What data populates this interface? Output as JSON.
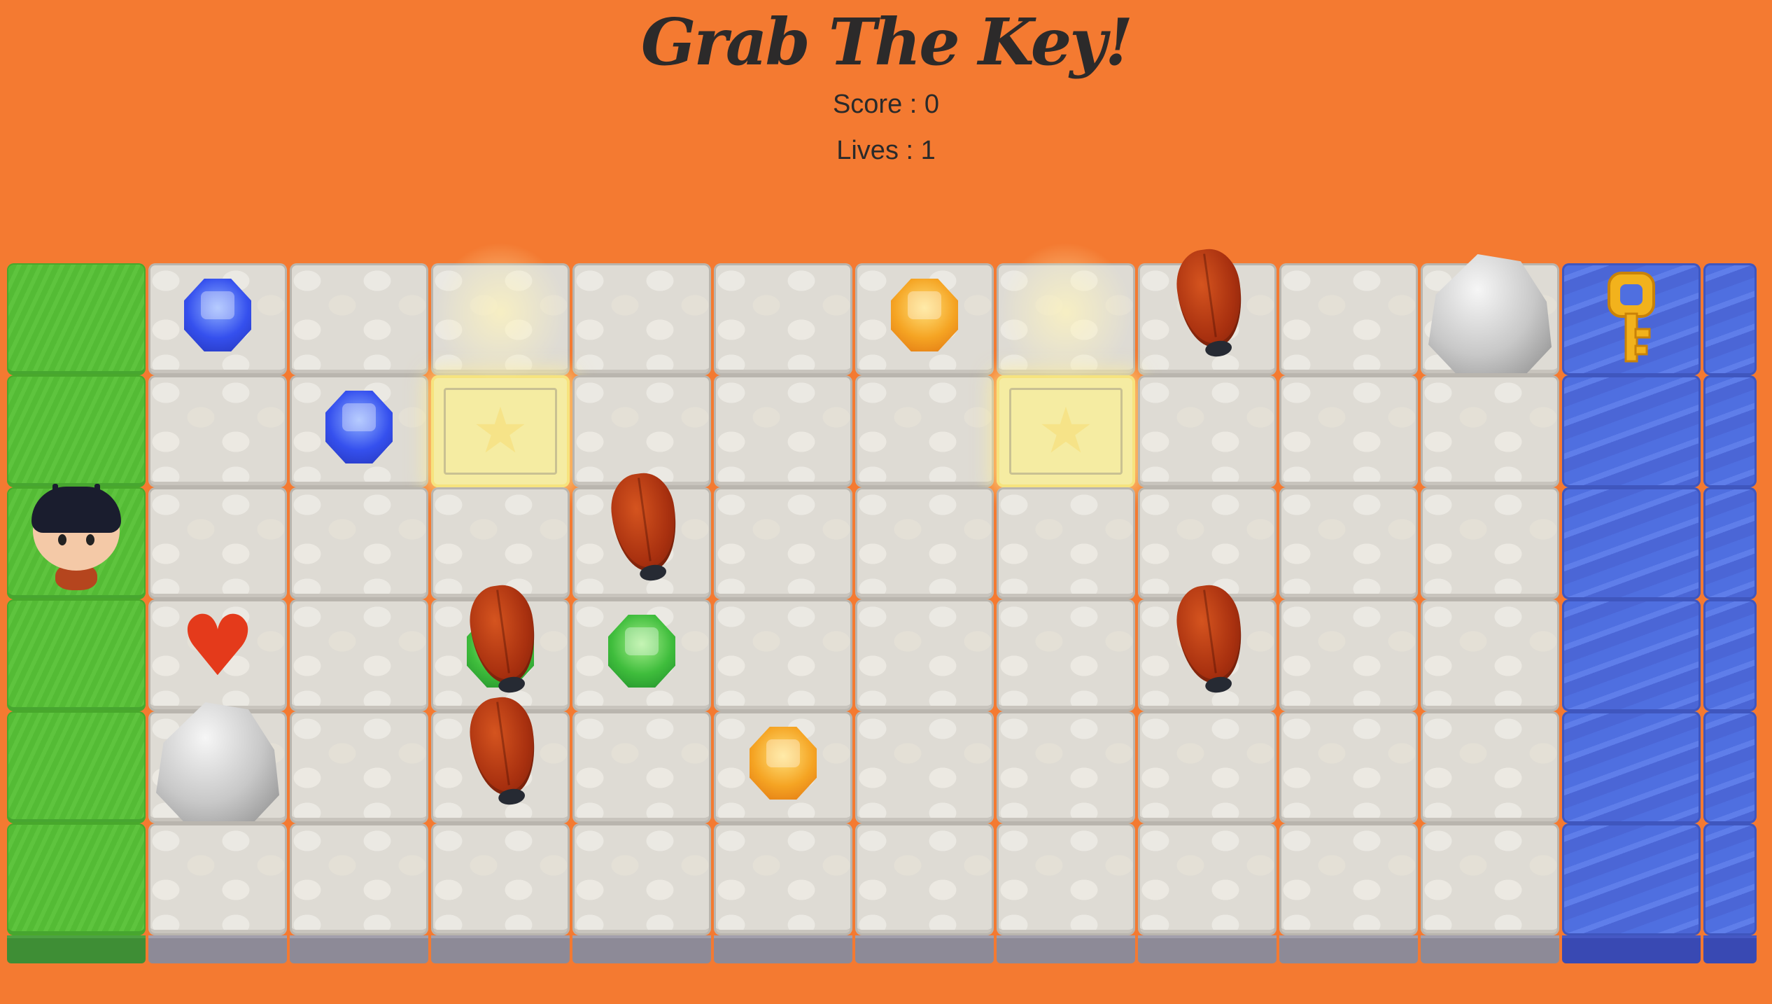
{
  "title": "Grab The Key!",
  "score_text": "Score : 0",
  "lives_text": "Lives : 1",
  "colors": {
    "background": "#f47a31",
    "title": "#2c2a2a"
  },
  "board": {
    "columns": 13,
    "rows": 6,
    "column_types": [
      "grass",
      "stone",
      "stone",
      "stone",
      "stone",
      "stone",
      "stone",
      "stone",
      "stone",
      "stone",
      "stone",
      "water",
      "water"
    ],
    "highlighted_tiles": [
      {
        "row": 1,
        "col": 3
      },
      {
        "row": 1,
        "col": 7
      }
    ],
    "items": [
      {
        "type": "blue-gem",
        "row": 0,
        "col": 1
      },
      {
        "type": "blue-gem",
        "row": 1,
        "col": 2
      },
      {
        "type": "orange-gem",
        "row": 0,
        "col": 6
      },
      {
        "type": "orange-gem",
        "row": 4,
        "col": 5
      },
      {
        "type": "green-gem",
        "row": 3,
        "col": 3
      },
      {
        "type": "green-gem",
        "row": 3,
        "col": 4
      },
      {
        "type": "heart",
        "row": 3,
        "col": 1
      },
      {
        "type": "rock",
        "row": 0,
        "col": 10
      },
      {
        "type": "rock",
        "row": 4,
        "col": 1
      },
      {
        "type": "key",
        "row": 0,
        "col": 11
      }
    ],
    "enemies": [
      {
        "type": "bug",
        "row": 0,
        "col": 8
      },
      {
        "type": "bug",
        "row": 2,
        "col": 4
      },
      {
        "type": "bug",
        "row": 3,
        "col": 3
      },
      {
        "type": "bug",
        "row": 4,
        "col": 3
      },
      {
        "type": "bug",
        "row": 3,
        "col": 8
      }
    ],
    "player": {
      "row": 2,
      "col": 0
    }
  }
}
